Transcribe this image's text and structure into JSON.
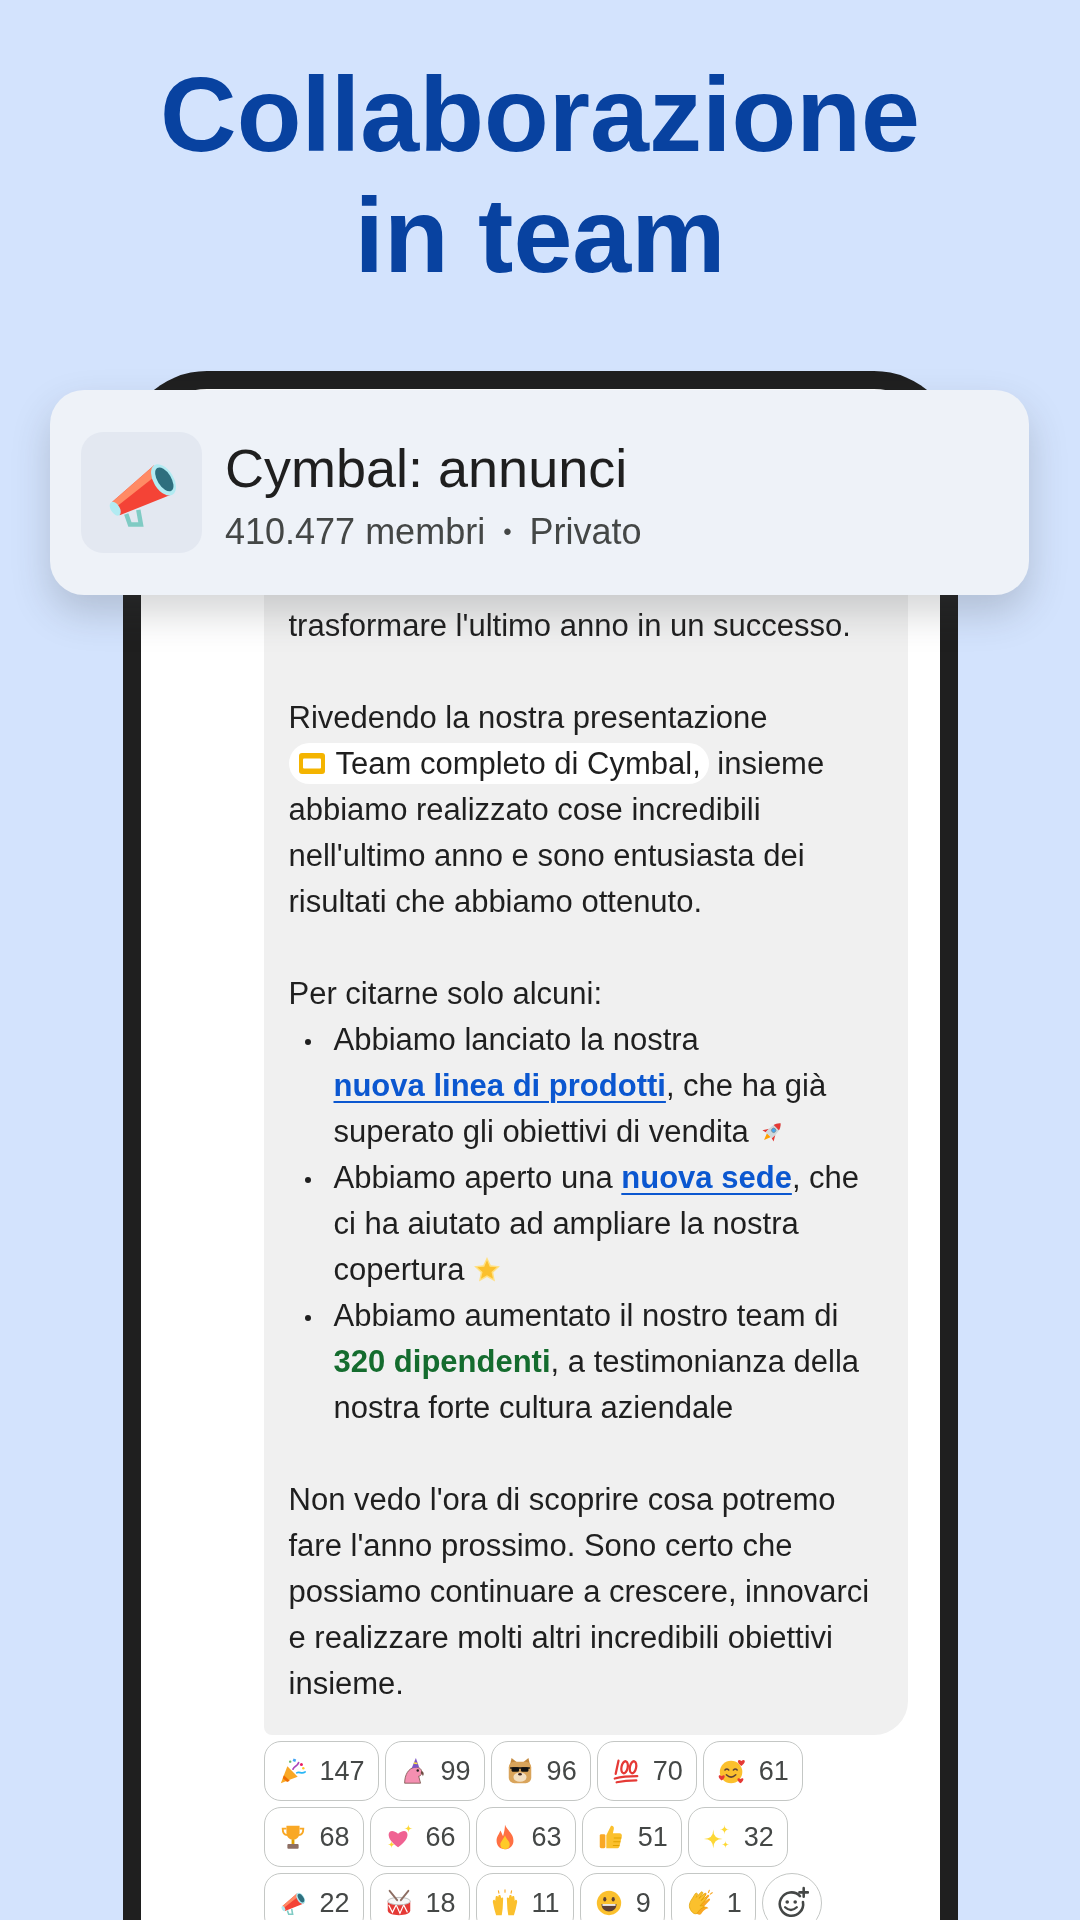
{
  "headline": "Collaborazione in team",
  "channel": {
    "title": "Cymbal: annunci",
    "members": "410.477 membri",
    "separator": "•",
    "visibility": "Privato"
  },
  "message": {
    "blocks": [
      {
        "kind": "paragraph",
        "parts": [
          {
            "kind": "text",
            "text": "trasformare l'ultimo anno in un successo."
          }
        ]
      },
      {
        "kind": "paragraph",
        "parts": [
          {
            "kind": "text",
            "text": "Rivedendo la nostra presentazione "
          },
          {
            "kind": "file",
            "text": "Team completo di Cymbal,"
          },
          {
            "kind": "text",
            "text": " insieme abbiamo realizzato cose incredibili nell'ultimo anno e sono entusiasta dei risultati che abbiamo ottenuto."
          }
        ]
      },
      {
        "kind": "paragraph",
        "parts": [
          {
            "kind": "text",
            "text": "Per citarne solo alcuni:"
          }
        ]
      },
      {
        "kind": "list",
        "items": [
          {
            "parts": [
              {
                "kind": "text",
                "text": "Abbiamo lanciato la nostra "
              },
              {
                "kind": "link",
                "text": "nuova linea di prodotti"
              },
              {
                "kind": "text",
                "text": ", che ha già superato gli obiettivi di vendita"
              },
              {
                "kind": "rocket"
              }
            ]
          },
          {
            "parts": [
              {
                "kind": "text",
                "text": "Abbiamo aperto una "
              },
              {
                "kind": "link",
                "text": "nuova sede"
              },
              {
                "kind": "text",
                "text": ", che ci ha aiutato ad ampliare la nostra copertura"
              },
              {
                "kind": "star"
              }
            ]
          },
          {
            "parts": [
              {
                "kind": "text",
                "text": "Abbiamo aumentato il nostro team di "
              },
              {
                "kind": "highlight",
                "text": "320 dipendenti"
              },
              {
                "kind": "text",
                "text": ", a testimonianza della nostra forte cultura aziendale"
              }
            ]
          }
        ]
      },
      {
        "kind": "paragraph",
        "parts": [
          {
            "kind": "text",
            "text": "Non vedo l'ora di scoprire cosa potremo fare l'anno prossimo. Sono certo che possiamo continuare a crescere, innovarci e realizzare molti altri incredibili obiettivi insieme."
          }
        ]
      }
    ]
  },
  "reactions": [
    {
      "kind": "party",
      "count": "147"
    },
    {
      "kind": "parrot",
      "count": "99"
    },
    {
      "kind": "doge",
      "count": "96"
    },
    {
      "kind": "hundred",
      "count": "70"
    },
    {
      "kind": "adoring",
      "count": "61"
    },
    {
      "kind": "trophy",
      "count": "68"
    },
    {
      "kind": "sparkleheart",
      "count": "66"
    },
    {
      "kind": "fire",
      "count": "63"
    },
    {
      "kind": "thumbsup",
      "count": "51"
    },
    {
      "kind": "sparkles",
      "count": "32"
    },
    {
      "kind": "megaphone",
      "count": "22"
    },
    {
      "kind": "drum",
      "count": "18"
    },
    {
      "kind": "hands",
      "count": "11"
    },
    {
      "kind": "grin",
      "count": "9"
    },
    {
      "kind": "clap",
      "count": "1"
    }
  ]
}
